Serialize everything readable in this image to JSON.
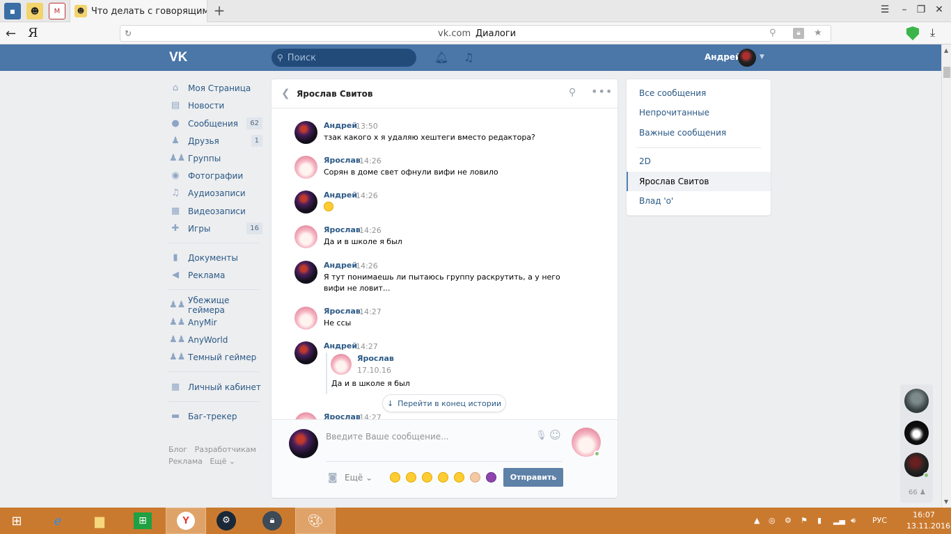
{
  "browser": {
    "tab_title": "Что делать с говорящим не",
    "new_tab_label": "+",
    "address_domain": "vk.com",
    "address_title": "Диалоги",
    "yandex_logo": "Я"
  },
  "vk": {
    "search_placeholder": "Поиск",
    "user_name": "Андрей"
  },
  "menu": {
    "items": [
      {
        "label": "Моя Страница",
        "icon": "home-icon"
      },
      {
        "label": "Новости",
        "icon": "news-icon"
      },
      {
        "label": "Сообщения",
        "icon": "chat-icon",
        "count": "62"
      },
      {
        "label": "Друзья",
        "icon": "person-icon",
        "count": "1"
      },
      {
        "label": "Группы",
        "icon": "group-icon"
      },
      {
        "label": "Фотографии",
        "icon": "camera-icon"
      },
      {
        "label": "Аудиозаписи",
        "icon": "music-icon"
      },
      {
        "label": "Видеозаписи",
        "icon": "film-icon"
      },
      {
        "label": "Игры",
        "icon": "gamepad-icon",
        "count": "16"
      },
      {
        "label": "Документы",
        "icon": "document-icon"
      },
      {
        "label": "Реклама",
        "icon": "megaphone-icon"
      },
      {
        "label": "Убежище геймера",
        "icon": "group-icon"
      },
      {
        "label": "AnyMir",
        "icon": "group-icon"
      },
      {
        "label": "AnyWorld",
        "icon": "group-icon"
      },
      {
        "label": "Темный геймер",
        "icon": "group-icon"
      },
      {
        "label": "Личный кабинет",
        "icon": "grid-icon"
      },
      {
        "label": "Баг-трекер",
        "icon": "briefcase-icon"
      }
    ],
    "footer": {
      "blog": "Блог",
      "developers": "Разработчикам",
      "ads": "Реклама",
      "more": "Ещё ⌄"
    }
  },
  "chat": {
    "title": "Ярослав Свитов",
    "messages": [
      {
        "author": "Андрей",
        "time": "13:50",
        "text": "тзак какого х я удаляю хештеги вместо редактора?"
      },
      {
        "author": "Ярослав",
        "time": "14:26",
        "text": "Сорян в доме свет офнули вифи не ловило"
      },
      {
        "author": "Андрей",
        "time": "14:26",
        "text": ""
      },
      {
        "author": "Ярослав",
        "time": "14:26",
        "text": "Да и в школе я был"
      },
      {
        "author": "Андрей",
        "time": "14:26",
        "text": "Я тут понимаешь ли пытаюсь группу раскрутить, а у него вифи не ловит..."
      },
      {
        "author": "Ярослав",
        "time": "14:27",
        "text": "Не ссы"
      },
      {
        "author": "Андрей",
        "time": "14:27",
        "text": ""
      },
      {
        "author": "Ярослав",
        "time": "14:27",
        "text": ""
      }
    ],
    "forwarded": {
      "author": "Ярослав",
      "date": "17.10.16",
      "text": "Да и в школе я был"
    },
    "jump_label": "Перейти в конец истории",
    "input_placeholder": "Введите Ваше сообщение...",
    "more_label": "Ещё ⌄",
    "send_label": "Отправить"
  },
  "filters": {
    "items": [
      {
        "label": "Все сообщения"
      },
      {
        "label": "Непрочитанные"
      },
      {
        "label": "Важные сообщения"
      },
      {
        "label": "2D"
      },
      {
        "label": "Ярослав Свитов"
      },
      {
        "label": "Влад 'о'"
      }
    ]
  },
  "friends_strip": {
    "count": "66"
  },
  "taskbar": {
    "language": "РУС",
    "time": "16:07",
    "date": "13.11.2016"
  },
  "colors": {
    "vk_header": "#4a76a8",
    "link": "#2a5885",
    "taskbar": "#ca7a2f",
    "send_button": "#5e81a8"
  }
}
